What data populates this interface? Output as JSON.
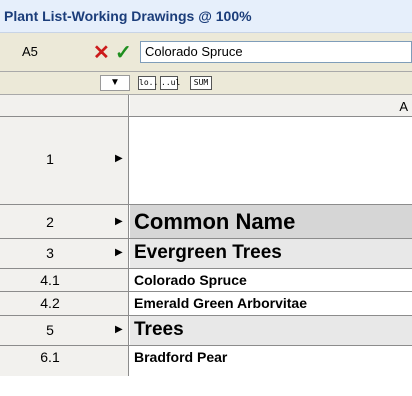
{
  "window": {
    "title": "Plant List-Working Drawings @ 100%"
  },
  "formula_bar": {
    "cell_ref": "A5",
    "value": "Colorado Spruce"
  },
  "toolbar": {
    "dropdown": "▼",
    "fmt1": "lo..",
    "fmt2": "..ul",
    "fmt3": "SUM"
  },
  "column_header": {
    "label": "A"
  },
  "rows": [
    {
      "num": "1",
      "text": ""
    },
    {
      "num": "2",
      "text": "Common Name"
    },
    {
      "num": "3",
      "text": "Evergreen Trees"
    },
    {
      "num": "4.1",
      "text": "Colorado Spruce"
    },
    {
      "num": "4.2",
      "text": "Emerald Green Arborvitae"
    },
    {
      "num": "5",
      "text": "Trees"
    },
    {
      "num": "6.1",
      "text": "Bradford Pear"
    }
  ]
}
